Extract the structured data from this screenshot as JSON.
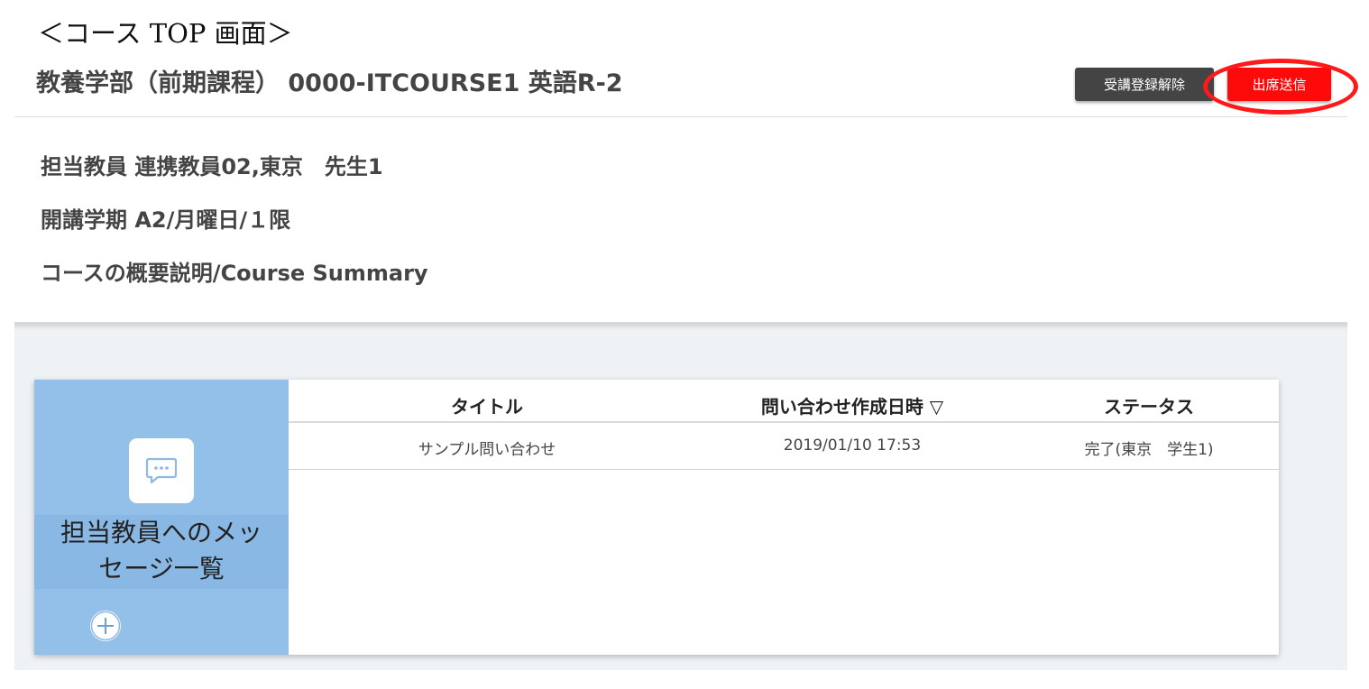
{
  "caption": "＜コース TOP 画面＞",
  "course": {
    "title": "教養学部（前期課程） 0000-ITCOURSE1 英語R-2"
  },
  "buttons": {
    "unregister_label": "受講登録解除",
    "attend_label": "出席送信"
  },
  "info": {
    "teacher": "担当教員 連携教員02,東京　先生1",
    "term": "開講学期 A2/月曜日/１限",
    "summary": "コースの概要説明/Course Summary"
  },
  "messages_panel": {
    "title_line1": "担当教員へのメッ",
    "title_line2": "セージ一覧",
    "icon": "chat-bubble-icon",
    "add_icon": "plus-icon"
  },
  "table": {
    "columns": [
      "タイトル",
      "問い合わせ作成日時 ▽",
      "ステータス"
    ],
    "rows": [
      [
        "サンプル問い合わせ",
        "2019/01/10 17:53",
        "完了(東京　学生1)"
      ]
    ]
  },
  "colors": {
    "attend_button": "#ff0a0a",
    "unregister_button": "#444444",
    "highlight": "#ff1a1a",
    "side_panel": "#93c0e8",
    "panel_bg": "#eef2f5"
  }
}
